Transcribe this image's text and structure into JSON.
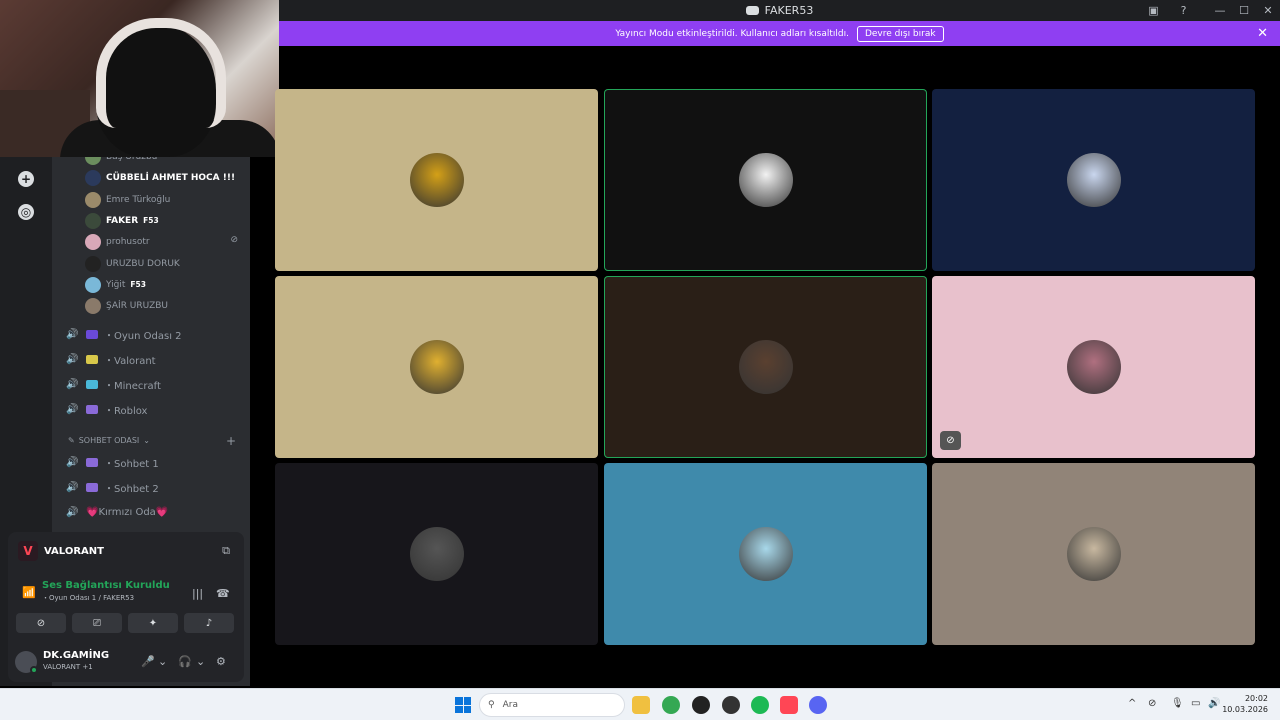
{
  "window": {
    "title": "FAKER53",
    "controls": [
      "minimize-icon",
      "maximize-icon",
      "close-icon"
    ]
  },
  "banner": {
    "message": "Yayıncı Modu etkinleştirildi. Kullanıcı adları kısaltıldı.",
    "button": "Devre dışı bırak"
  },
  "members": [
    {
      "name": "Baş Uruzbu",
      "color": "#6b8e5e",
      "bold": false,
      "tag": ""
    },
    {
      "name": "CÜBBELİ AHMET HOCA !!!",
      "color": "#2b3a5c",
      "bold": true,
      "tag": ""
    },
    {
      "name": "Emre Türkoğlu",
      "color": "#9a8a6a",
      "bold": false,
      "tag": ""
    },
    {
      "name": "FAKER",
      "color": "#3b4a3b",
      "bold": true,
      "tag": "F53"
    },
    {
      "name": "prohusotr",
      "color": "#d8a8b8",
      "bold": false,
      "tag": "",
      "muted": true
    },
    {
      "name": "URUZBU DORUK",
      "color": "#222",
      "bold": false,
      "tag": ""
    },
    {
      "name": "Yiğit",
      "color": "#7ab8d8",
      "bold": false,
      "tag": "F53"
    },
    {
      "name": "ŞAİR URUZBU",
      "color": "#8a7a6a",
      "bold": false,
      "tag": ""
    }
  ],
  "voice_channels": [
    {
      "name": "・Oyun Odası 2",
      "icon_color": "#6a4ad8"
    },
    {
      "name": "・Valorant",
      "icon_color": "#d8c84a"
    },
    {
      "name": "・Minecraft",
      "icon_color": "#4ab8d8"
    },
    {
      "name": "・Roblox",
      "icon_color": "#8a6ad8"
    }
  ],
  "category": {
    "label": "SOHBET ODASI"
  },
  "chat_channels": [
    {
      "name": "・Sohbet 1",
      "icon_color": "#8a6ad8"
    },
    {
      "name": "・Sohbet 2",
      "icon_color": "#8a6ad8"
    },
    {
      "name": "💗Kırmızı Oda💗",
      "icon_color": ""
    }
  ],
  "activity": {
    "game": "VALORANT"
  },
  "voice_status": {
    "title": "Ses Bağlantısı Kuruldu",
    "subtitle": "・Oyun Odası 1 / FAKER53"
  },
  "user": {
    "name": "DK.GAMİNG",
    "status": "VALORANT +1"
  },
  "tiles": [
    {
      "bg": "#c5b589",
      "avatar": "#d4a017",
      "speaking": false,
      "muted": false
    },
    {
      "bg": "#111111",
      "avatar": "#f2f2f2",
      "speaking": true,
      "muted": false
    },
    {
      "bg": "#132040",
      "avatar": "#c9d6ee",
      "speaking": false,
      "muted": false
    },
    {
      "bg": "#c5b589",
      "avatar": "#e0b030",
      "speaking": false,
      "muted": false
    },
    {
      "bg": "#2a1f17",
      "avatar": "#5a4030",
      "speaking": true,
      "muted": false
    },
    {
      "bg": "#e8c1cc",
      "avatar": "#b07080",
      "speaking": false,
      "muted": true
    },
    {
      "bg": "#17161b",
      "avatar": "#555",
      "speaking": false,
      "muted": false
    },
    {
      "bg": "#3f8aab",
      "avatar": "#a8d8ea",
      "speaking": false,
      "muted": false
    },
    {
      "bg": "#918478",
      "avatar": "#c8b8a0",
      "speaking": false,
      "muted": false
    }
  ],
  "taskbar": {
    "search_placeholder": "Ara",
    "time": "20:02",
    "date": "10.03.2026"
  }
}
